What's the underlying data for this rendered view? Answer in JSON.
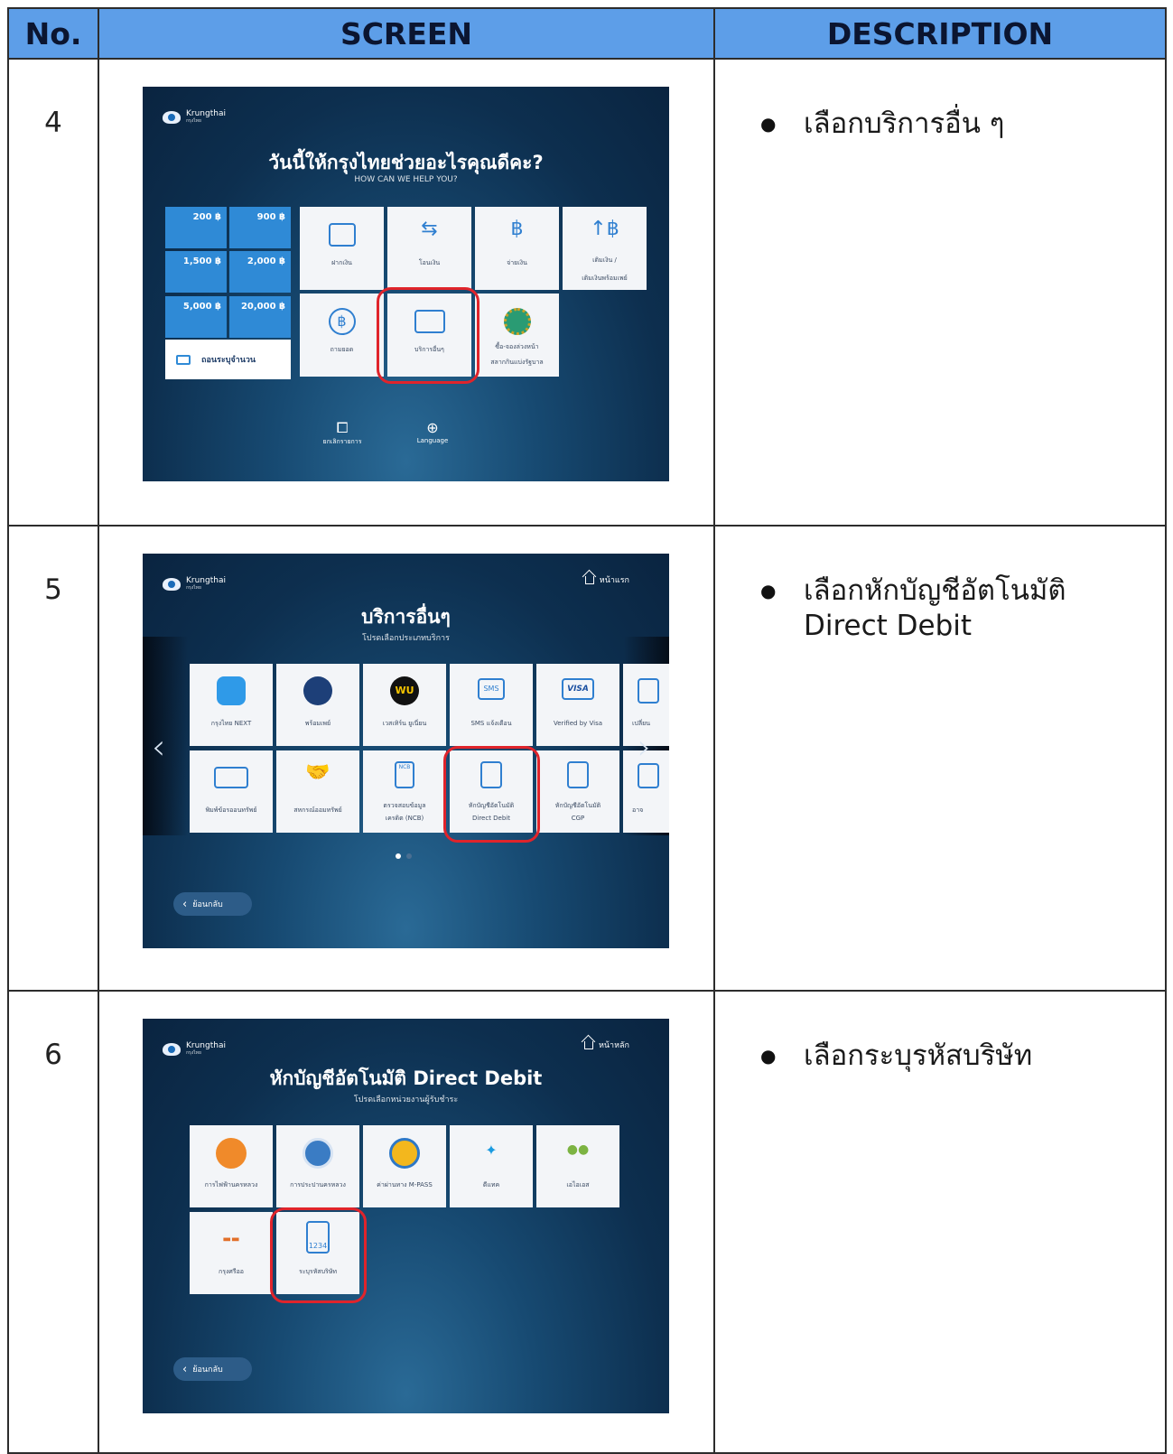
{
  "headers": {
    "no": "No.",
    "screen": "SCREEN",
    "description": "DESCRIPTION"
  },
  "rows": [
    {
      "no": "4",
      "description": [
        "เลือกบริการอื่น ๆ"
      ],
      "screen": {
        "brand": "Krungthai",
        "brand_sub": "กรุงไทย",
        "title": "วันนี้ให้กรุงไทยช่วยอะไรคุณดีคะ?",
        "subtitle": "HOW CAN WE HELP YOU?",
        "amounts": [
          "200 ฿",
          "900 ฿",
          "1,500 ฿",
          "2,000 ฿",
          "5,000 ฿",
          "20,000 ฿"
        ],
        "input_amount": "ถอนระบุจำนวน",
        "services": [
          "ฝากเงิน",
          "โอนเงิน",
          "จ่ายเงิน",
          "เติมเงิน /",
          "เติมเงินพร้อมเพย์",
          "ถามยอด",
          "บริการอื่นๆ",
          "ซื้อ-จองล่วงหน้า",
          "สลากกินแบ่งรัฐบาล"
        ],
        "footer": [
          "ยกเลิกรายการ",
          "Language"
        ]
      }
    },
    {
      "no": "5",
      "description": [
        "เลือกหักบัญชีอัตโนมัติ",
        "Direct Debit"
      ],
      "screen": {
        "brand": "Krungthai",
        "brand_sub": "กรุงไทย",
        "home": "หน้าแรก",
        "title": "บริการอื่นๆ",
        "subtitle": "โปรดเลือกประเภทบริการ",
        "row1": [
          "กรุงไทย NEXT",
          "พร้อมเพย์",
          "เวสเทิร์น ยูเนี่ยน",
          "SMS แจ้งเตือน",
          "Verified by Visa",
          "เปลี่ยน"
        ],
        "row1_icon_text": [
          "",
          "",
          "WU",
          "SMS",
          "VISA",
          ""
        ],
        "row2": [
          "พิมพ์ข้อรออนทรัพย์",
          "สหกรณ์ออมทรัพย์",
          "ตรวจสอบข้อมูล",
          "เครดิต (NCB)",
          "หักบัญชีอัตโนมัติ",
          "Direct Debit",
          "หักบัญชีอัตโนมัติ",
          "CGP",
          "อาจ"
        ],
        "ncb_icon": "NCB",
        "back": "ย้อนกลับ"
      }
    },
    {
      "no": "6",
      "description": [
        "เลือกระบุรหัสบริษัท"
      ],
      "screen": {
        "brand": "Krungthai",
        "brand_sub": "กรุงไทย",
        "home": "หน้าหลัก",
        "title": "หักบัญชีอัตโนมัติ Direct Debit",
        "subtitle": "โปรดเลือกหน่วยงานผู้รับชำระ",
        "row1": [
          "การไฟฟ้านครหลวง",
          "การประปานครหลวง",
          "ค่าผ่านทาง M-PASS",
          "ดีแทค",
          "เอไอเอส"
        ],
        "row2": [
          "กรุงศรีออ",
          "ระบุรหัสบริษัท"
        ],
        "code_icon": "1234",
        "back": "ย้อนกลับ"
      }
    }
  ],
  "colors": {
    "header_bg": "#5d9ee8",
    "highlight": "#e0242b",
    "tile_blue": "#2f8ad6"
  }
}
